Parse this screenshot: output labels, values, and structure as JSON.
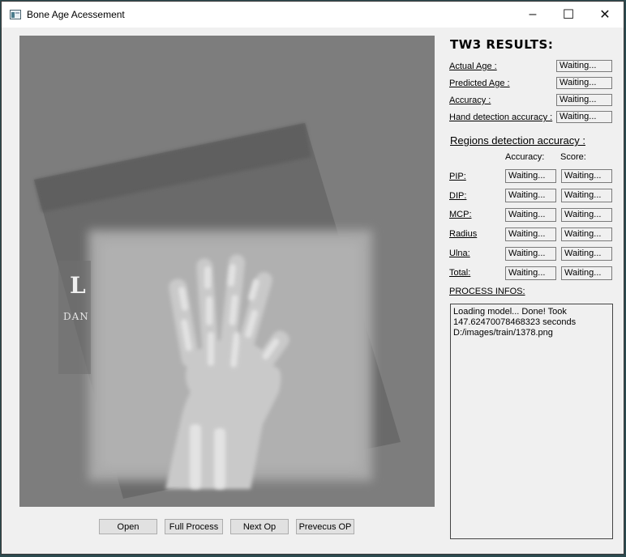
{
  "window": {
    "title": "Bone Age Acessement",
    "controls": {
      "minimize": "–",
      "maximize": "☐",
      "close": "✕"
    }
  },
  "xray": {
    "marker_letter": "L",
    "marker_text": "DAN"
  },
  "buttons": {
    "open": "Open",
    "full_process": "Full Process",
    "next_op": "Next Op",
    "previous_op": "Prevecus OP"
  },
  "results": {
    "title": "TW3 RESULTS:",
    "actual_age": {
      "label": "Actual Age :",
      "value": "Waiting..."
    },
    "predicted_age": {
      "label": "Predicted Age :",
      "value": "Waiting..."
    },
    "accuracy": {
      "label": "Accuracy :",
      "value": "Waiting..."
    },
    "hand_detection": {
      "label": "Hand detection accuracy :",
      "value": "Waiting..."
    }
  },
  "regions": {
    "title": "Regions detection accuracy :",
    "col_accuracy": "Accuracy:",
    "col_score": "Score:",
    "rows": [
      {
        "label": "PIP:",
        "accuracy": "Waiting...",
        "score": "Waiting..."
      },
      {
        "label": "DIP:",
        "accuracy": "Waiting...",
        "score": "Waiting..."
      },
      {
        "label": "MCP:",
        "accuracy": "Waiting...",
        "score": "Waiting..."
      },
      {
        "label": "Radius",
        "accuracy": "Waiting...",
        "score": "Waiting..."
      },
      {
        "label": "Ulna:",
        "accuracy": "Waiting...",
        "score": "Waiting..."
      },
      {
        "label": "Total:",
        "accuracy": "Waiting...",
        "score": "Waiting..."
      }
    ]
  },
  "process": {
    "title": "PROCESS INFOS:",
    "log": "Loading model... Done! Took\n147.62470078468323 seconds\nD:/images/train/1378.png"
  }
}
